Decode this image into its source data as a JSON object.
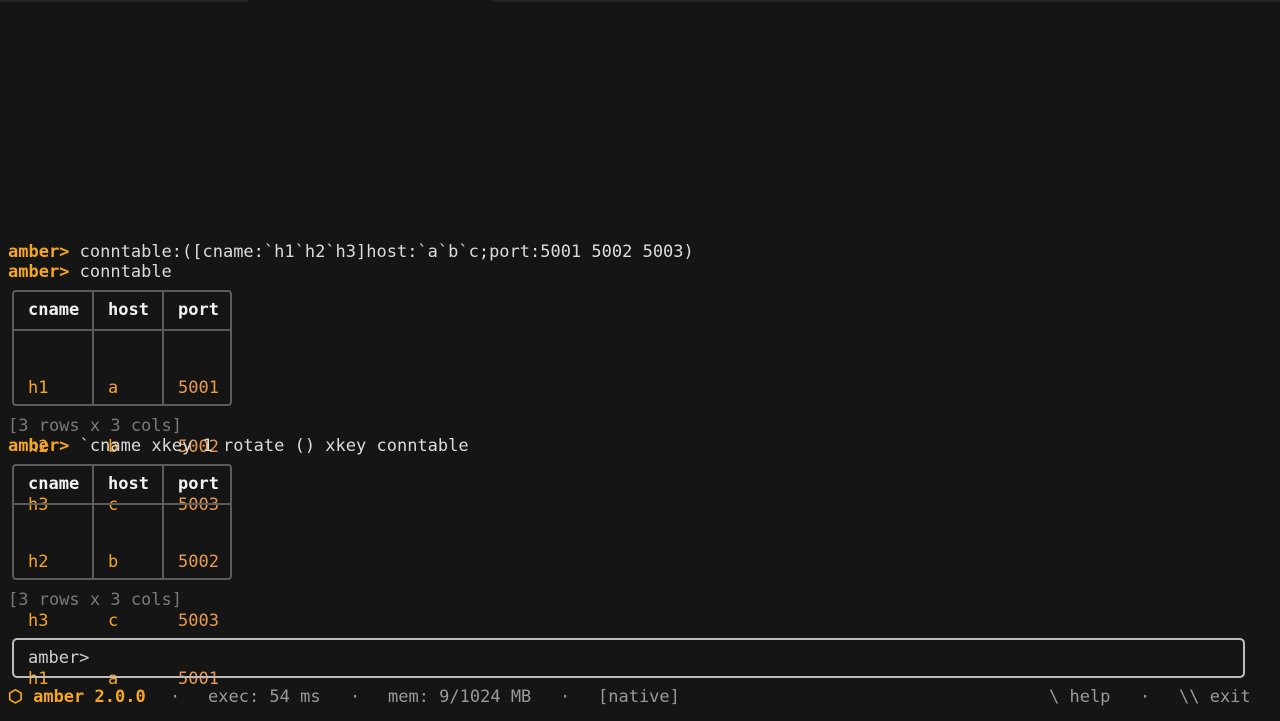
{
  "prompt": "amber>",
  "history": [
    {
      "prompt": "amber>",
      "command": "conntable:([cname:`h1`h2`h3]host:`a`b`c;port:5001 5002 5003)"
    },
    {
      "prompt": "amber>",
      "command": "conntable"
    },
    {
      "prompt": "amber>",
      "command": "`cname xkey 1 rotate () xkey conntable"
    }
  ],
  "tables": [
    {
      "columns": [
        "cname",
        "host",
        "port"
      ],
      "rows": [
        [
          "h1",
          "a",
          "5001"
        ],
        [
          "h2",
          "b",
          "5002"
        ],
        [
          "h3",
          "c",
          "5003"
        ]
      ],
      "summary": "[3 rows x 3 cols]"
    },
    {
      "columns": [
        "cname",
        "host",
        "port"
      ],
      "rows": [
        [
          "h2",
          "b",
          "5002"
        ],
        [
          "h3",
          "c",
          "5003"
        ],
        [
          "h1",
          "a",
          "5001"
        ]
      ],
      "summary": "[3 rows x 3 cols]"
    }
  ],
  "input": {
    "prompt": "amber>",
    "value": ""
  },
  "statusbar": {
    "brand_icon": "⬡",
    "brand": "amber 2.0.0",
    "exec": "exec: 54 ms",
    "mem": "mem: 9/1024 MB",
    "mode": "[native]",
    "help": "\\ help",
    "exit": "\\\\ exit",
    "separator": "·"
  },
  "colors": {
    "accent": "#f5a623",
    "background": "#151515"
  }
}
